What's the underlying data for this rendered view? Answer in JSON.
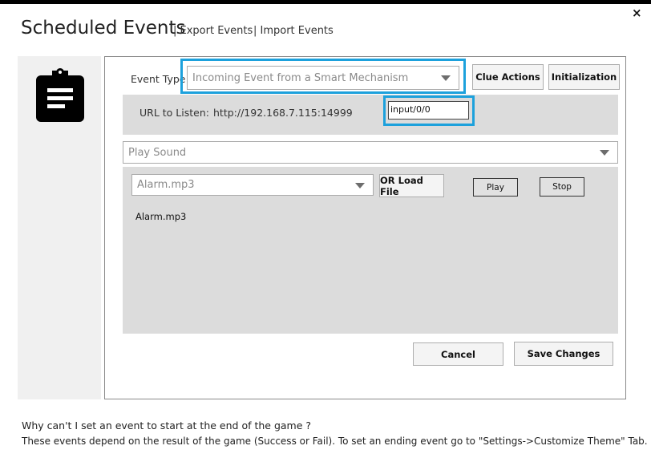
{
  "window": {
    "title": "Scheduled Events",
    "close_glyph": "×"
  },
  "header": {
    "links": [
      "| Export Events",
      "| Import Events"
    ]
  },
  "event_type": {
    "label": "Event Type",
    "value": "Incoming Event from a Smart Mechanism",
    "buttons": {
      "clue_actions": "Clue Actions",
      "initialization": "Initialization"
    }
  },
  "url": {
    "label": "URL to Listen:",
    "value": "http://192.168.7.115:14999",
    "path_input": "input/0/0"
  },
  "action": {
    "value": "Play Sound"
  },
  "sound": {
    "file_value": "Alarm.mp3",
    "load_button": "OR Load File",
    "play_button": "Play",
    "stop_button": "Stop",
    "current_file": "Alarm.mp3"
  },
  "dialog_buttons": {
    "cancel": "Cancel",
    "save": "Save Changes"
  },
  "footer": {
    "question": "Why can't I set an event to start at the end of the game ?",
    "answer": "These events depend on the result of the game (Success or Fail). To set an ending event go to \"Settings->Customize Theme\" Tab."
  },
  "colors": {
    "highlight": "#1da1dc",
    "panel": "#dcdcdc"
  },
  "icons": {
    "side": "clipboard-icon"
  }
}
